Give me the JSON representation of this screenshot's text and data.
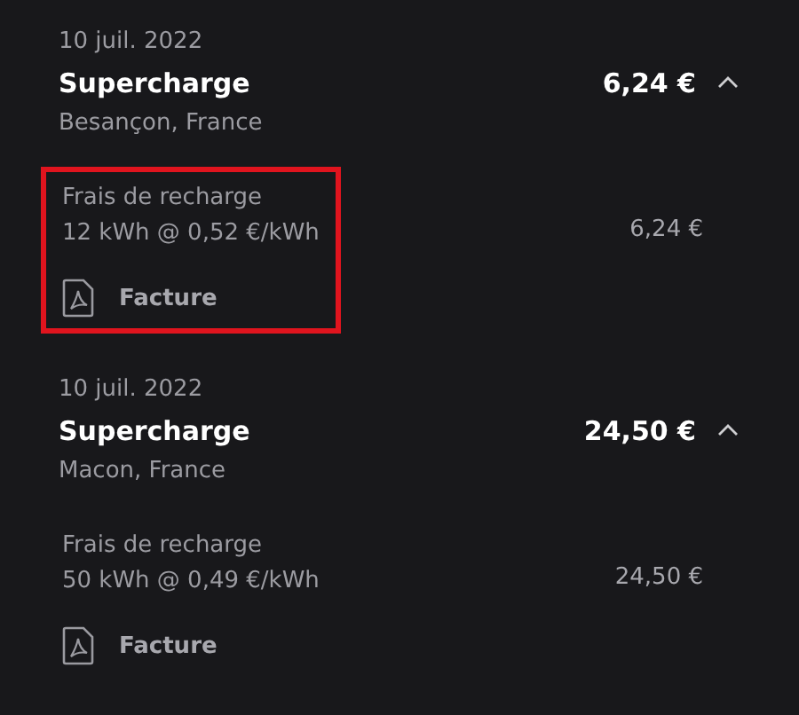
{
  "charges": [
    {
      "date": "10 juil. 2022",
      "title": "Supercharge",
      "location": "Besançon, France",
      "total": "6,24 €",
      "expanded": true,
      "fee_label": "Frais de recharge",
      "fee_detail": "12 kWh @ 0,52 €/kWh",
      "fee_amount": "6,24 €",
      "invoice": "Facture",
      "highlighted": true
    },
    {
      "date": "10 juil. 2022",
      "title": "Supercharge",
      "location": "Macon, France",
      "total": "24,50 €",
      "expanded": true,
      "fee_label": "Frais de recharge",
      "fee_detail": "50 kWh @ 0,49 €/kWh",
      "fee_amount": "24,50 €",
      "invoice": "Facture",
      "highlighted": false
    }
  ]
}
